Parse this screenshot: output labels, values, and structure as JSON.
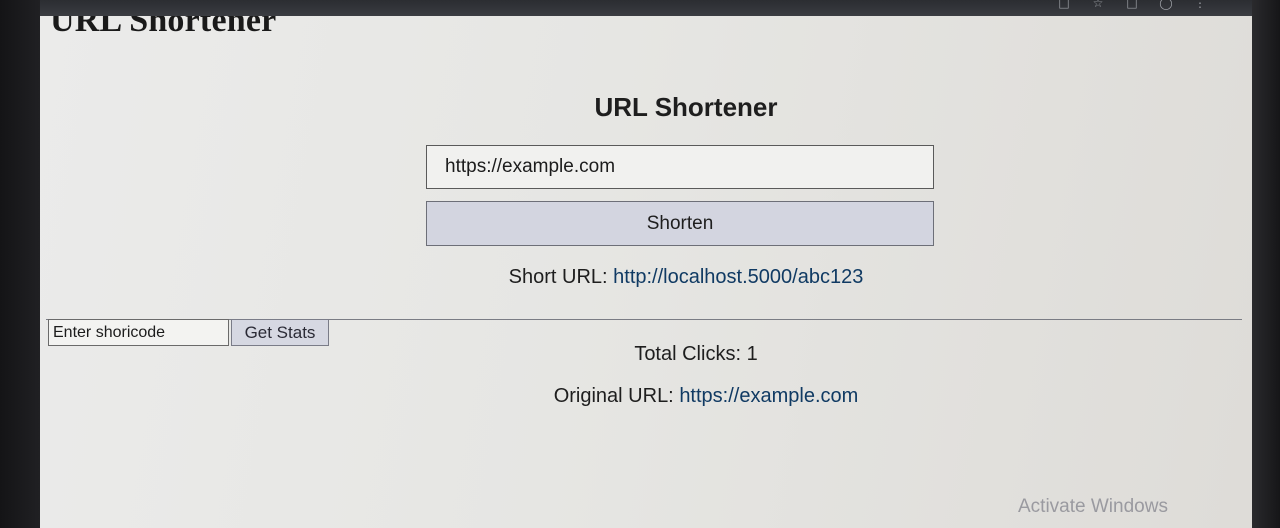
{
  "browser": {
    "icons": [
      "square-icon",
      "star-icon",
      "panel-icon",
      "profile-icon",
      "more-icon"
    ]
  },
  "header": {
    "title": "URL Shortener"
  },
  "shortener": {
    "title": "URL Shortener",
    "url_input_value": "https://example.com",
    "shorten_label": "Shorten",
    "short_url_label": "Short URL: ",
    "short_url_value": "http://localhost.5000/abc123"
  },
  "stats": {
    "shortcode_placeholder": "Enter shoricode",
    "get_stats_label": "Get Stats",
    "total_clicks_label": "Total Clicks: ",
    "total_clicks_value": "1",
    "original_url_label": "Original URL: ",
    "original_url_value": "https://example.com"
  },
  "watermark": {
    "text": "Activate Windows"
  },
  "colors": {
    "link": "#103a63",
    "button_bg": "#d3d5e0",
    "page_bg": "#e8e8e6"
  }
}
